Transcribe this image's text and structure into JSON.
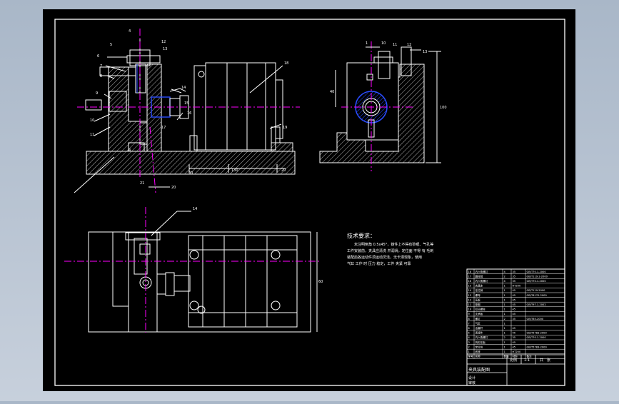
{
  "colors": {
    "background": "#b9c4d2",
    "sheet": "#000000",
    "line": "#ffffff",
    "centerline": "#ff00ff",
    "blue_component": "#2a4cff",
    "hatch": "#ffffff"
  },
  "callouts": {
    "front_view": [
      "4",
      "5",
      "6",
      "7",
      "8",
      "9",
      "10",
      "11",
      "12",
      "13",
      "14",
      "15",
      "16",
      "17",
      "18",
      "19",
      "20",
      "21"
    ],
    "side_view": [
      "1",
      "10",
      "11",
      "12",
      "13"
    ],
    "plan_view": [
      "14"
    ]
  },
  "dimensions": {
    "front": [
      "20",
      "130",
      "20",
      "15",
      "16"
    ],
    "side": [
      "40",
      "100"
    ],
    "plan": [
      "60"
    ]
  },
  "tech_requirements": {
    "title": "技术要求：",
    "lines": [
      "未注明倒角 0.5x45°，铸件上不得有砂眼、气孔等",
      "工件安装前，夹具应清洗 并润滑，定位面 不得 有 毛刺",
      "装配后各运动件须运动灵活，无卡滞现象，使用",
      "气缸 工作 时 压力 稳定，工件 夹紧 可靠"
    ]
  },
  "bom_rows": [
    [
      "18",
      "内六角螺钉",
      "4",
      "35",
      "GB/T70.1-2000"
    ],
    [
      "17",
      "圆柱销",
      "2",
      "35",
      "GB/T119.1-2000"
    ],
    [
      "16",
      "内六角螺钉",
      "4",
      "35",
      "GB/T70.1-2000"
    ],
    [
      "15",
      "夹具体",
      "1",
      "HT200",
      ""
    ],
    [
      "14",
      "定位销",
      "1",
      "45",
      "GB/T119-2000"
    ],
    [
      "13",
      "螺母",
      "1",
      "45",
      "GB/T6170-2000"
    ],
    [
      "12",
      "压板",
      "1",
      "45",
      ""
    ],
    [
      "11",
      "垫圈",
      "1",
      "45",
      "GB/T97.1-2002"
    ],
    [
      "10",
      "双头螺柱",
      "1",
      "45",
      ""
    ],
    [
      "9",
      "支承板",
      "1",
      "45",
      ""
    ],
    [
      "8",
      "螺钉",
      "2",
      "35",
      "GB/T65-2000"
    ],
    [
      "7",
      "气缸",
      "1",
      "",
      ""
    ],
    [
      "6",
      "活塞杆",
      "1",
      "45",
      ""
    ],
    [
      "5",
      "连接件",
      "1",
      "45",
      "GB/T5783-2000"
    ],
    [
      "4",
      "内六角螺钉",
      "2",
      "35",
      "GB/T70.1-2000"
    ],
    [
      "3",
      "钩形压板",
      "1",
      "45",
      ""
    ],
    [
      "2",
      "定位块",
      "1",
      "45",
      "GB/T5783-2000"
    ],
    [
      "1",
      "底座",
      "1",
      "HT200",
      ""
    ]
  ],
  "bom_header": [
    "序号",
    "名称",
    "数量",
    "材料",
    "备注"
  ],
  "title_block": {
    "drawing_title": "夹具装配图",
    "scale_label": "比例",
    "scale": "1:1",
    "sheet_label": "共",
    "sheet": "张",
    "designer": "设计",
    "checker": "审核"
  }
}
